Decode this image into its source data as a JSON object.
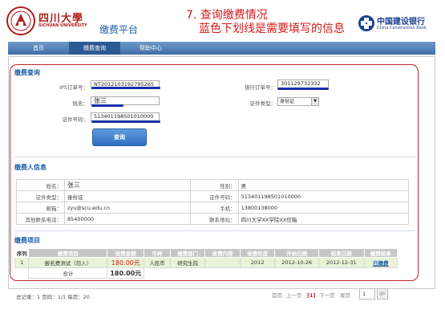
{
  "header": {
    "university_name": "四川大學",
    "university_sub": "SICHUAN UNIVERSITY",
    "platform_title": "缴费平台",
    "note_line1": "7. 查询缴费情况",
    "note_line2": "蓝色下划线是需要填写的信息",
    "bank_cn": "中国建设银行",
    "bank_en": "China Construction Bank"
  },
  "nav": {
    "items": [
      "首页",
      "缴费查询",
      "帮助中心"
    ],
    "active": "缴费查询"
  },
  "query": {
    "title": "缴费查询",
    "ips_label": "IPS订单号：",
    "ips_value": "NT2012103192795265",
    "bank_order_label": "银行订单号：",
    "bank_order_value": "301129732332",
    "name_label": "姓名：",
    "name_value": "张三",
    "id_type_label": "证件类型：",
    "id_type_value": "身份证",
    "id_number_label": "证件号码：",
    "id_number_value": "513401198501010000",
    "query_button": "查询"
  },
  "payer": {
    "title": "缴费人信息",
    "rows": [
      {
        "k1": "姓名：",
        "v1": "张三",
        "k2": "性别：",
        "v2": "男"
      },
      {
        "k1": "证件类型：",
        "v1": "身份证",
        "k2": "证件号码：",
        "v2": "513401198501010000"
      },
      {
        "k1": "邮箱：",
        "v1": "zyu@scu.edu.cn",
        "k2": "手机：",
        "v2": "13800138000"
      },
      {
        "k1": "其他联系电话：",
        "v1": "85400000",
        "k2": "联系地址：",
        "v2": "四川大学XX学院XX信箱"
      }
    ]
  },
  "items": {
    "title": "缴费项目",
    "headers": [
      "序列",
      "缴费项目",
      "收费金额",
      "币种",
      "缴费部门",
      "收费内容",
      "收费年度",
      "开始日期",
      "结束日期",
      "缴费结果"
    ],
    "rows": [
      {
        "seq": "1",
        "item": "报名费测试（勿入）",
        "amount": "180.00元",
        "currency": "人民币",
        "dept": "研究生院",
        "content": "",
        "year": "2012",
        "start": "2012-10-26",
        "end": "2012-12-31",
        "status": "已缴费"
      }
    ],
    "total_label": "合计",
    "total_value": "180.00元"
  },
  "footer": {
    "summary": "总记录：1 页码：1/1 每页：20",
    "first": "首页",
    "prev": "上一页",
    "current": "[1]",
    "next": "下一页",
    "last": "尾页",
    "page_input": "1",
    "go": "go"
  }
}
